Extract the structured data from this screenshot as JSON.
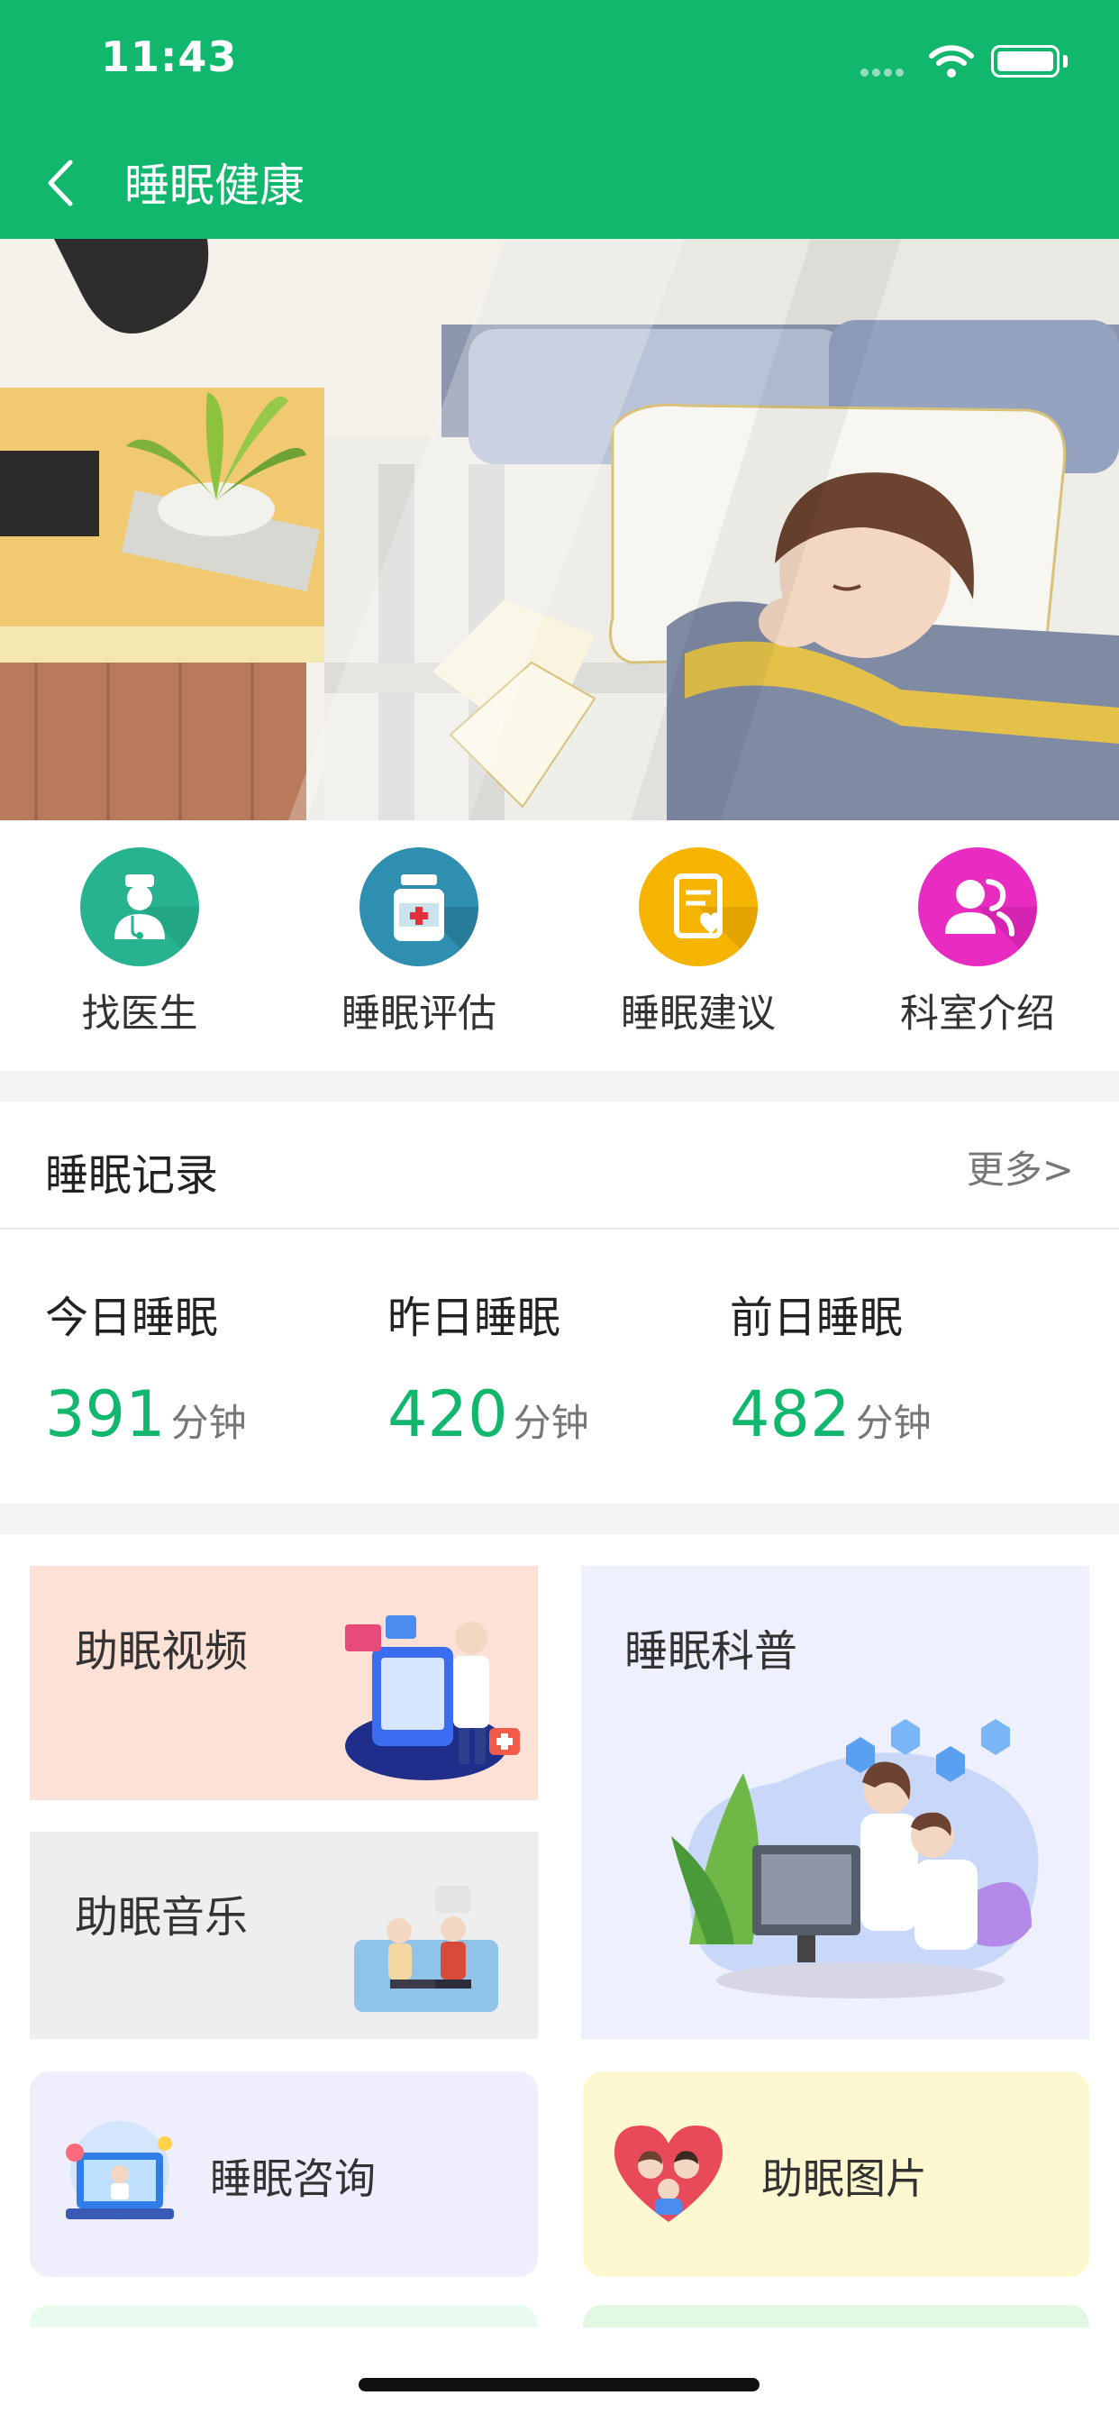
{
  "status_bar": {
    "time": "11:43"
  },
  "nav": {
    "title": "睡眠健康"
  },
  "quick_actions": [
    {
      "label": "找医生",
      "icon": "doctor-icon",
      "color": "#27b38f"
    },
    {
      "label": "睡眠评估",
      "icon": "medicine-bottle-icon",
      "color": "#2f8fb0"
    },
    {
      "label": "睡眠建议",
      "icon": "clipboard-heart-icon",
      "color": "#f5b400"
    },
    {
      "label": "科室介绍",
      "icon": "users-icon",
      "color": "#e82cc2"
    }
  ],
  "sleep_record": {
    "title": "睡眠记录",
    "more": "更多>",
    "stats": [
      {
        "label": "今日睡眠",
        "value": "391",
        "unit": "分钟"
      },
      {
        "label": "昨日睡眠",
        "value": "420",
        "unit": "分钟"
      },
      {
        "label": "前日睡眠",
        "value": "482",
        "unit": "分钟"
      }
    ]
  },
  "cards": {
    "video": {
      "title": "助眠视频",
      "bg": "#fde0d6"
    },
    "music": {
      "title": "助眠音乐",
      "bg": "#eeeeee"
    },
    "science": {
      "title": "睡眠科普",
      "bg": "#eef1fd"
    },
    "consult": {
      "title": "睡眠咨询",
      "bg": "#efeefc"
    },
    "pictures": {
      "title": "助眠图片",
      "bg": "#fdf8cf"
    }
  },
  "colors": {
    "brand": "#12b76e"
  }
}
